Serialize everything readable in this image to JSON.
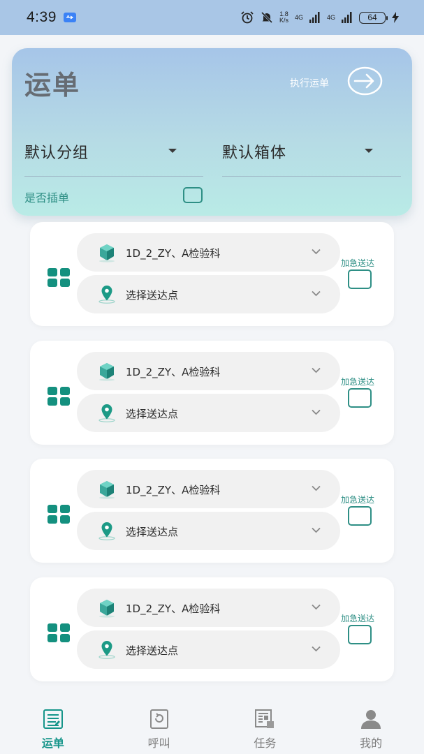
{
  "status_bar": {
    "time": "4:39",
    "net_speed_value": "1.8",
    "net_speed_unit": "K/s",
    "signal1": "4G",
    "signal2": "4G",
    "battery": "64"
  },
  "header": {
    "title": "运单",
    "execute_label": "执行运单",
    "group_dropdown": "默认分组",
    "box_dropdown": "默认箱体",
    "insert_label": "是否插单",
    "insert_checked": false
  },
  "waybills": [
    {
      "department": "1D_2_ZY、A检验科",
      "destination": "选择送达点",
      "urgent_label": "加急送达",
      "urgent_checked": false
    },
    {
      "department": "1D_2_ZY、A检验科",
      "destination": "选择送达点",
      "urgent_label": "加急送达",
      "urgent_checked": false
    },
    {
      "department": "1D_2_ZY、A检验科",
      "destination": "选择送达点",
      "urgent_label": "加急送达",
      "urgent_checked": false
    },
    {
      "department": "1D_2_ZY、A检验科",
      "destination": "选择送达点",
      "urgent_label": "加急送达",
      "urgent_checked": false
    }
  ],
  "bottom_nav": {
    "items": [
      {
        "label": "运单",
        "icon": "waybill-icon",
        "active": true
      },
      {
        "label": "呼叫",
        "icon": "call-icon",
        "active": false
      },
      {
        "label": "任务",
        "icon": "task-icon",
        "active": false
      },
      {
        "label": "我的",
        "icon": "profile-icon",
        "active": false
      }
    ]
  },
  "colors": {
    "accent": "#16958a",
    "header_gradient_top": "#a6c5e8",
    "header_gradient_bottom": "#b9ebe6"
  }
}
